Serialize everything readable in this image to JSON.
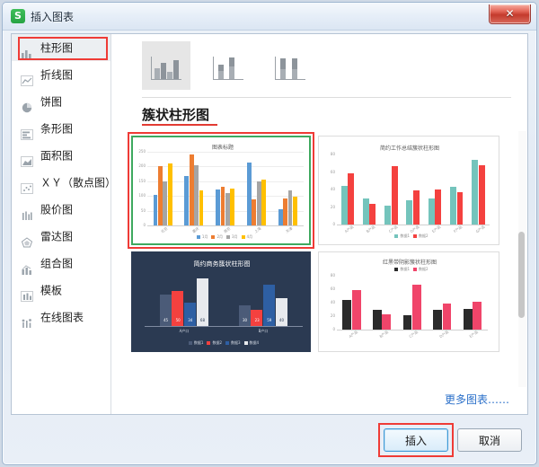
{
  "window": {
    "title": "插入图表",
    "app_icon": "S",
    "close_label": "✕"
  },
  "sidebar": {
    "items": [
      {
        "label": "柱形图",
        "icon": "column-chart-icon",
        "selected": true
      },
      {
        "label": "折线图",
        "icon": "line-chart-icon",
        "selected": false
      },
      {
        "label": "饼图",
        "icon": "pie-chart-icon",
        "selected": false
      },
      {
        "label": "条形图",
        "icon": "bar-chart-icon",
        "selected": false
      },
      {
        "label": "面积图",
        "icon": "area-chart-icon",
        "selected": false
      },
      {
        "label": "ＸＹ（散点图）",
        "icon": "scatter-chart-icon",
        "selected": false
      },
      {
        "label": "股价图",
        "icon": "stock-chart-icon",
        "selected": false
      },
      {
        "label": "雷达图",
        "icon": "radar-chart-icon",
        "selected": false
      },
      {
        "label": "组合图",
        "icon": "combo-chart-icon",
        "selected": false
      },
      {
        "label": "模板",
        "icon": "template-icon",
        "selected": false
      },
      {
        "label": "在线图表",
        "icon": "online-chart-icon",
        "selected": false
      }
    ]
  },
  "main": {
    "type_thumbnails": [
      {
        "name": "clustered-column",
        "selected": true
      },
      {
        "name": "stacked-column",
        "selected": false
      },
      {
        "name": "100-stacked-column",
        "selected": false
      }
    ],
    "section_title": "簇状柱形图",
    "more_link": "更多图表……"
  },
  "footer": {
    "insert_label": "插入",
    "cancel_label": "取消"
  },
  "colors": {
    "accent_red": "#ef3b36",
    "accent_green": "#3ea95f",
    "link_blue": "#2a6fc9",
    "series_blue": "#5b9bd5",
    "series_orange": "#ed7d31",
    "series_gray": "#a5a5a5",
    "series_yellow": "#ffc000",
    "teal": "#74c4bc",
    "red": "#f4413f",
    "dark_navy": "#2b3a52",
    "dark_bar_blue": "#2e5fa3",
    "light_gray_bar": "#e8eaee",
    "black_bar": "#2b2b2b",
    "pink_bar": "#f0456a"
  },
  "chart_data": [
    {
      "type": "bar",
      "card_name": "chart-preview-clustered-column",
      "title": "图表标题",
      "selected": true,
      "categories": [
        "北京",
        "重庆",
        "南京",
        "上海",
        "天津"
      ],
      "series": [
        {
          "name": "1月",
          "color": "#5b9bd5",
          "values": [
            105,
            168,
            122,
            213,
            55
          ]
        },
        {
          "name": "2月",
          "color": "#ed7d31",
          "values": [
            200,
            240,
            130,
            87,
            90
          ]
        },
        {
          "name": "3月",
          "color": "#a5a5a5",
          "values": [
            150,
            205,
            110,
            150,
            120
          ]
        },
        {
          "name": "4月",
          "color": "#ffc000",
          "values": [
            210,
            120,
            125,
            155,
            98
          ]
        }
      ],
      "ylim": [
        0,
        250
      ],
      "yticks": [
        0,
        50,
        100,
        150,
        200,
        250
      ],
      "legend": "bottom",
      "grid": true
    },
    {
      "type": "bar",
      "card_name": "chart-preview-simple-summary",
      "title": "简约工作总结簇状柱形图",
      "selected": false,
      "categories": [
        "A产品",
        "B产品",
        "C产品",
        "D产品",
        "E产品",
        "F产品",
        "G产品"
      ],
      "series": [
        {
          "name": "数据1",
          "color": "#74c4bc",
          "values": [
            44,
            30,
            22,
            28,
            30,
            43,
            74
          ]
        },
        {
          "name": "数据2",
          "color": "#f4413f",
          "values": [
            58,
            24,
            67,
            39,
            40,
            37,
            68
          ]
        }
      ],
      "ylim": [
        0,
        80
      ],
      "yticks": [
        0,
        20,
        40,
        60,
        80
      ],
      "legend": "bottom",
      "grid": false
    },
    {
      "type": "bar",
      "card_name": "chart-preview-business-dark",
      "title": "简约商务簇状柱形图",
      "selected": false,
      "theme": "dark",
      "categories": [
        "A产口",
        "B产口"
      ],
      "series": [
        {
          "name": "数据1",
          "color": "#4b5b78",
          "values": [
            45,
            30
          ]
        },
        {
          "name": "数据2",
          "color": "#f4413f",
          "values": [
            50,
            23
          ]
        },
        {
          "name": "数据3",
          "color": "#2e5fa3",
          "values": [
            34,
            59
          ]
        },
        {
          "name": "数据4",
          "color": "#e8eaee",
          "values": [
            68,
            40
          ]
        }
      ],
      "data_labels": [
        [
          45,
          50,
          34,
          68
        ],
        [
          30,
          23,
          59,
          40
        ]
      ],
      "ylim": [
        0,
        80
      ],
      "legend": "bottom",
      "grid": false
    },
    {
      "type": "bar",
      "card_name": "chart-preview-red-black-shadow",
      "title": "红黑带阴影簇状柱形图",
      "selected": false,
      "categories": [
        "A产品",
        "B产品",
        "C产品",
        "D产品",
        "E产品"
      ],
      "series": [
        {
          "name": "数据1",
          "color": "#2b2b2b",
          "values": [
            44,
            30,
            22,
            29,
            31
          ]
        },
        {
          "name": "数据2",
          "color": "#f0456a",
          "values": [
            59,
            23,
            67,
            39,
            41
          ]
        }
      ],
      "ylim": [
        0,
        80
      ],
      "yticks": [
        0,
        20,
        40,
        60,
        80
      ],
      "legend": "top",
      "grid": false
    }
  ]
}
